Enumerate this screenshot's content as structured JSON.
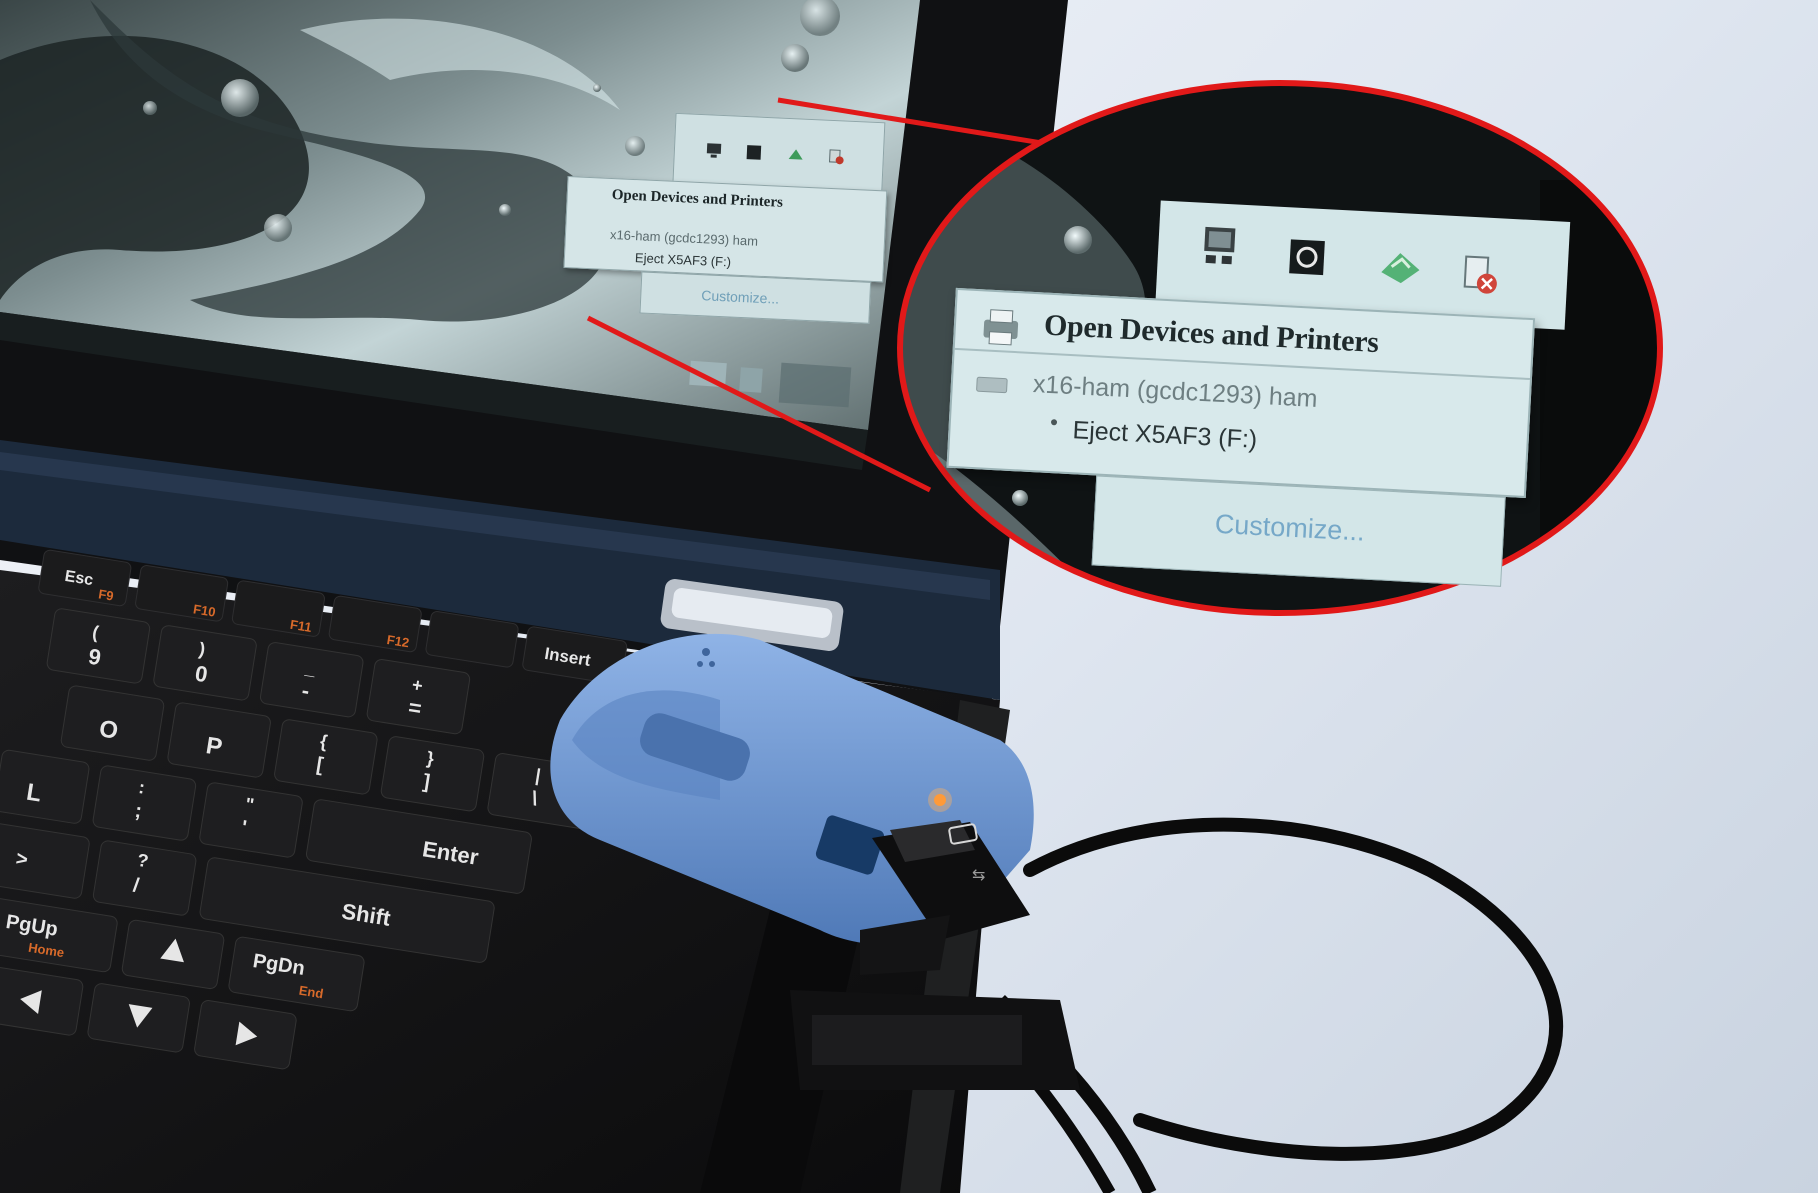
{
  "tray_menu": {
    "title": "Open Devices and Printers",
    "device": "x16-ham (gcdc1293) ham",
    "eject": "Eject X5AF3 (F:)",
    "customize": "Customize..."
  },
  "tray_icons": [
    "monitor-icon",
    "app-icon",
    "network-icon",
    "safely-remove-icon"
  ],
  "keyboard": {
    "keys": [
      "Esc",
      "F9",
      "F10",
      "F11",
      "F12",
      "Insert",
      "9",
      "0",
      "(",
      ")",
      "-",
      "_",
      "=",
      "+",
      "O",
      "P",
      "[",
      "{",
      "]",
      "}",
      "L",
      ";",
      ":",
      "'",
      "\"",
      "\\",
      "|",
      "Enter",
      ">",
      "?",
      "/",
      "Shift",
      "PgUp",
      "Home",
      "PgDn",
      "End"
    ]
  },
  "colors": {
    "callout": "#e11919",
    "usb_device": "#6b94d0",
    "led": "#ff8a1e",
    "popup_bg": "#d5e5e7",
    "customize_link": "#6f9fb8",
    "fn_labels": "#d86a2a"
  }
}
